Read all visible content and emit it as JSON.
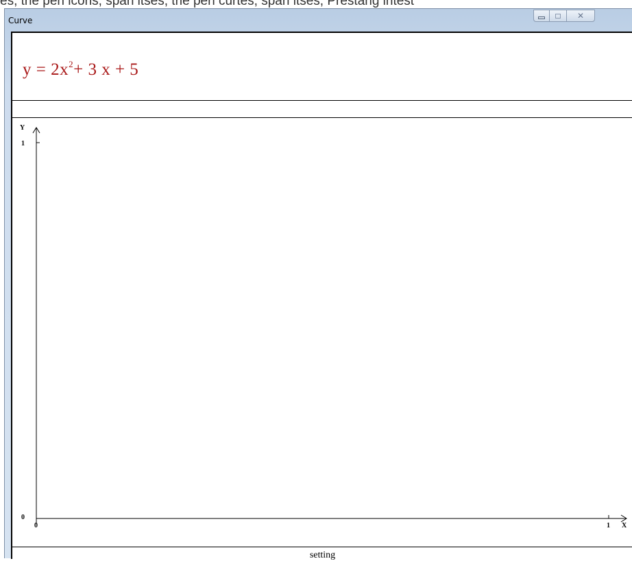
{
  "background_text": "es, trie pen icons, span itses, trie pen curtes, span itses, Prestang intest",
  "window": {
    "title": "Curve",
    "controls": {
      "minimize": "minimize",
      "maximize": "maximize",
      "close": "close"
    }
  },
  "formula": {
    "lhs": "y = 2x",
    "exponent": "2",
    "rhs": "+ 3 x + 5",
    "color": "#a81616"
  },
  "graph": {
    "x_axis_label": "X",
    "y_axis_label": "Y",
    "origin_x_tick": "0",
    "origin_y_tick": "0",
    "x_max_tick": "1",
    "y_max_tick": "1"
  },
  "footer": {
    "setting_label": "setting"
  }
}
